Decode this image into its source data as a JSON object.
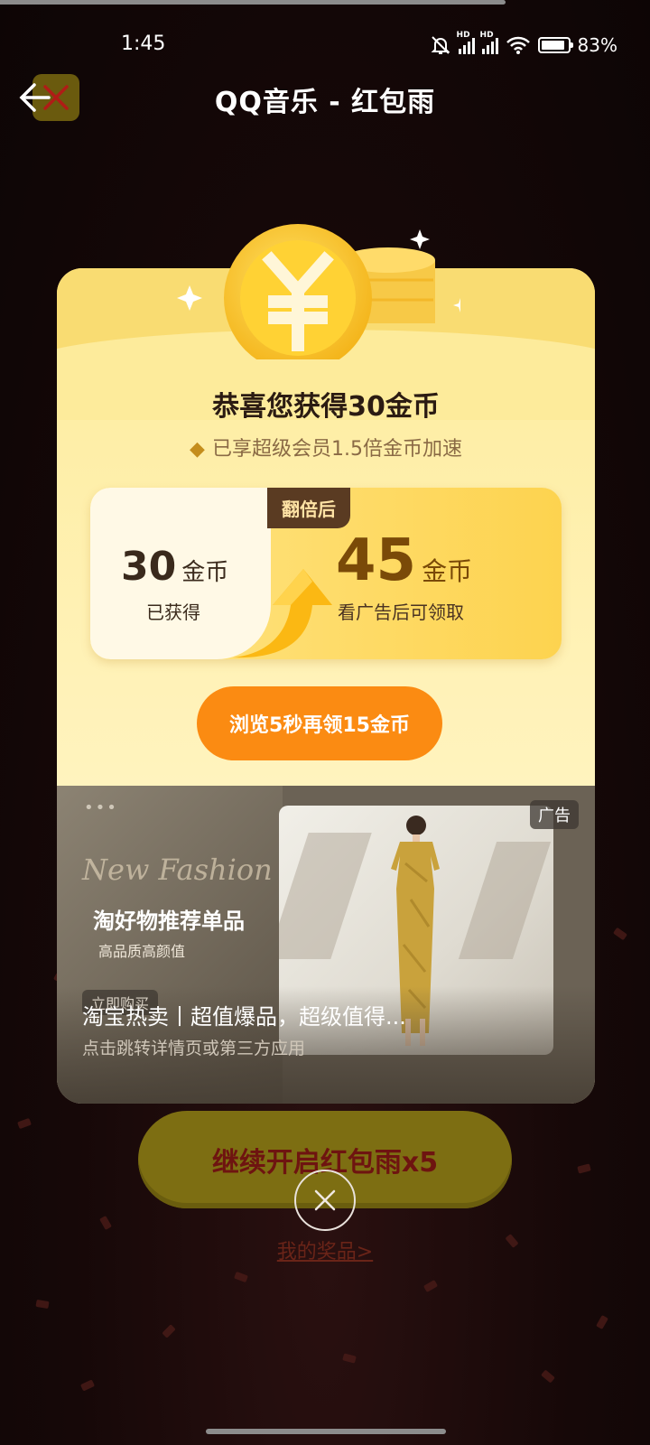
{
  "status_bar": {
    "time": "1:45",
    "battery": "83%",
    "icons": [
      "mute-bell-icon",
      "hd-signal-icon",
      "hd-signal-icon",
      "wifi-icon",
      "battery-icon"
    ]
  },
  "header": {
    "title": "QQ音乐 - 红包雨"
  },
  "reward": {
    "congrats": "恭喜您获得30金币",
    "vip_note": "已享超级会员1.5倍金币加速",
    "double_badge": "翻倍后",
    "earned_amount": "30",
    "earned_unit": "金币",
    "earned_label": "已获得",
    "doubled_amount": "45",
    "doubled_unit": "金币",
    "doubled_label": "看广告后可领取",
    "browse_button": "浏览5秒再领15金币"
  },
  "ad": {
    "dots": "•••",
    "script_text": "New Fashion",
    "headline": "淘好物推荐单品",
    "subline": "高品质高颜值",
    "tag": "广告",
    "buy_chip": "立即购买",
    "title": "淘宝热卖丨超值爆品，超级值得...",
    "description": "点击跳转详情页或第三方应用"
  },
  "bottom": {
    "continue_button": "继续开启红包雨x5",
    "my_prizes_link": "我的奖品>"
  },
  "colors": {
    "accent_orange": "#fb8b12",
    "card_yellow": "#fdeb9b",
    "background": "#120707"
  }
}
